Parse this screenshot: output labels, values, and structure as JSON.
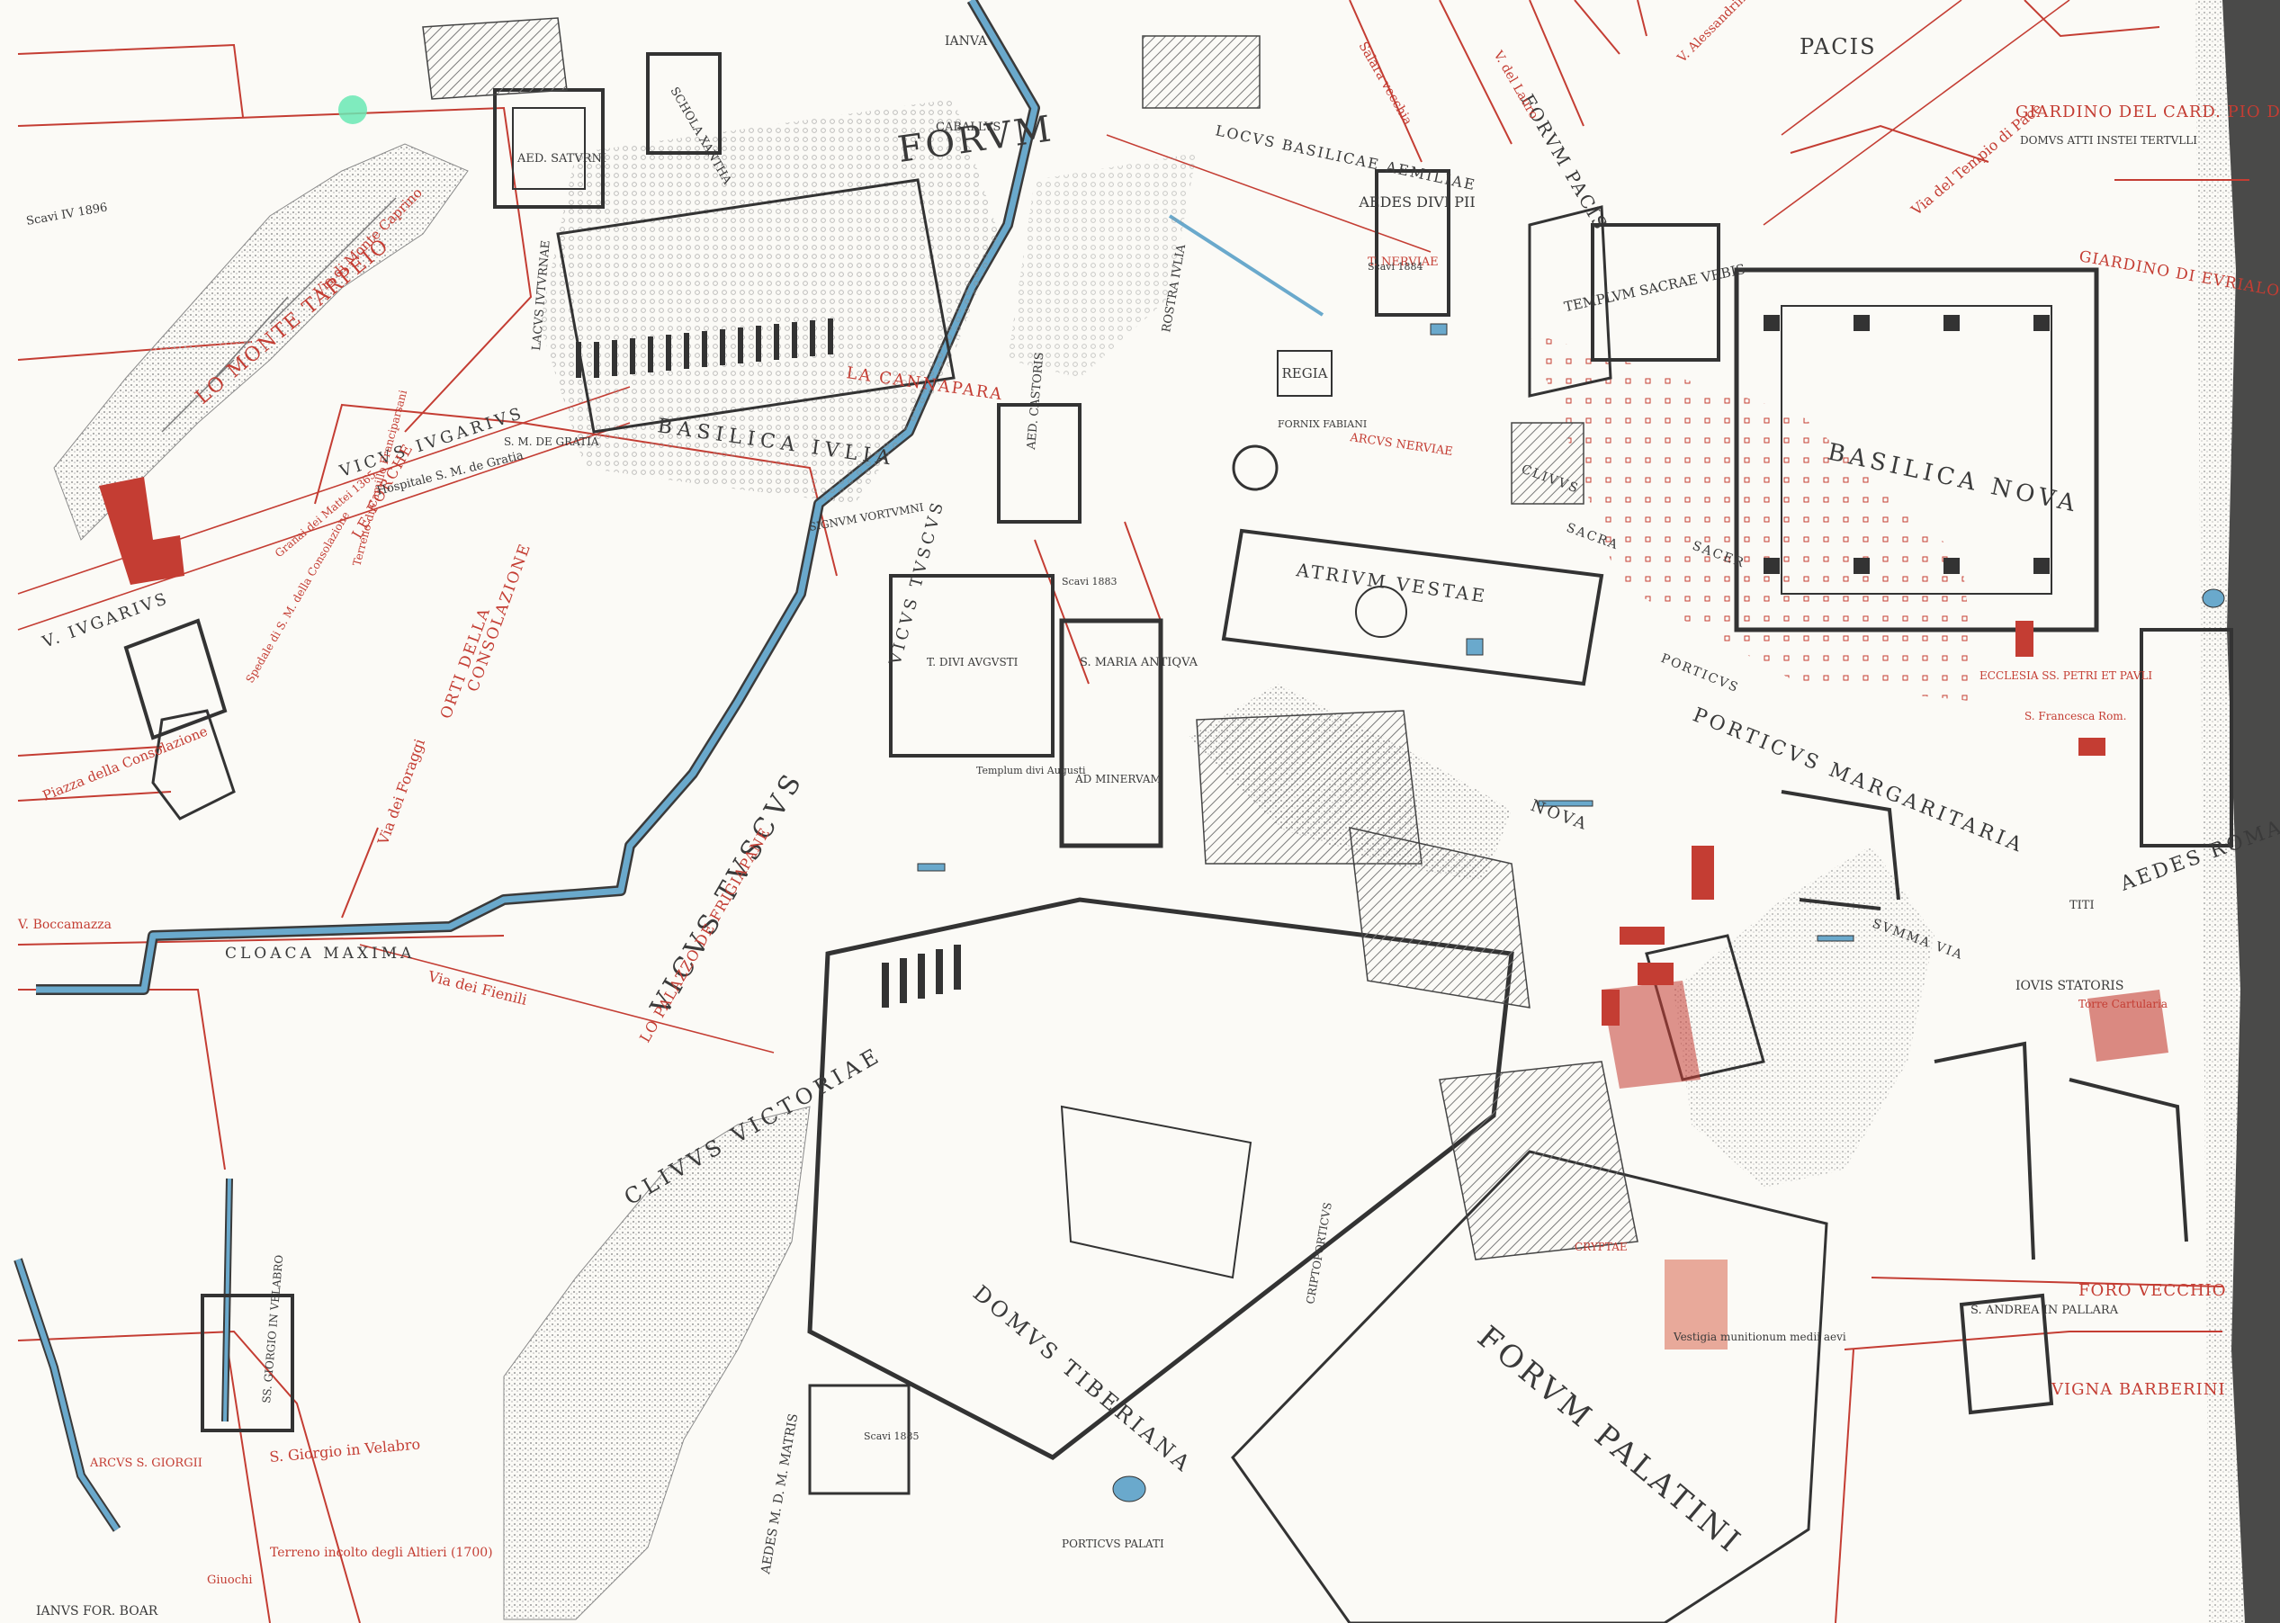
{
  "map": {
    "colors": {
      "paper": "#fbfaf6",
      "modern_red": "#c43d33",
      "ancient_ink": "#3a3a3a",
      "water_blue": "#6aa9cc",
      "hatch_grey": "#9a9a9a"
    },
    "labels": {
      "forum": "FORVM",
      "basilica_julia": "BASILICA IVLIA",
      "basilica_nova": "BASILICA NOVA",
      "forum_pacis": "FORVM PACIS",
      "pacis": "PACIS",
      "locus_basilicae": "LOCVS BASILICAE AEMILIAE",
      "aedes_divi_pii": "AEDES DIVI PII",
      "templum_sacrae_urbis": "TEMPLVM SACRAE VRBIS",
      "regia": "REGIA",
      "atrium_vestae": "ATRIVM VESTAE",
      "porticus_margaritaria": "PORTICVS MARGARITARIA",
      "nova_via": "NOVA",
      "summa_via": "SVMMA VIA",
      "vicus_jugarius": "VICVS IVGARIVS",
      "v_jugarius": "V. IVGARIVS",
      "vicus_tuscus_1": "VICVS TVSCVS",
      "vicus_tuscus_2": "VICVS TVSCVS",
      "clivus_victoriae": "CLIVVS VICTORIAE",
      "domus_tiberiana": "DOMVS TIBERIANA",
      "forum_palatini": "FORVM PALATINI",
      "aedes_romae": "AEDES ROMAE",
      "iovis_statoris": "IOVIS STATORIS",
      "cloaca_maxima": "CLOACA MAXIMA",
      "schola_xantha": "SCHOLA XANTHA",
      "aed_saturni": "AED. SATVRNI",
      "aed_castoris": "AED. CASTORIS",
      "s_maria_antiqua": "S. MARIA ANTIQVA",
      "ad_minervam": "AD MINERVAM",
      "t_divi_augusti": "T. DIVI AVGVSTI",
      "arcus_s_giorgii": "ARCVS S. GIORGII",
      "ianus_for_boar": "IANVS FOR. BOAR",
      "aedes_m_d_m_matris": "AEDES M. D. M. MATRIS",
      "cryptoporticus": "CRIPTOPORTICVS",
      "porticus": "PORTICVS",
      "sacra": "SACRA",
      "sacer": "SACER",
      "clivus": "CLIVVS",
      "giardino_pio_di_carpi": "GIARDINO DEL CARD. PIO DI CARPI",
      "giardino_evrialo": "GIARDINO DI EVRIALO SILVESTRI",
      "domus_atti": "DOMVS ATTI INSTEI TERTVLLI",
      "la_cannapara": "LA CANNAPARA",
      "monte_tarpeio": "LO MONTE TARPEIO",
      "via_monte_caprino": "Via di Monte Caprino",
      "le_forche": "LE FORCHE",
      "consolazione": "CONSOLAZIONE",
      "orti_della": "ORTI DELLA",
      "via_dei_foraggi": "Via dei Foraggi",
      "piazza_consolazione": "Piazza della Consolazione",
      "via_dei_fienili": "Via dei Fienili",
      "v_boccamazza": "V. Boccamazza",
      "s_giorgio_velabro": "S. Giorgio in Velabro",
      "palazzo_frigiapane": "LO PALAZZO DE FRIGIAPANE",
      "foro_vecchio": "FORO VECCHIO",
      "vigna_barberini": "VIGNA BARBERINI",
      "s_andrea_pallara": "S. ANDREA IN PALLARA",
      "turris_cartularia": "Torre Cartularia",
      "via_tempio_pace": "Via del Tempio di Pace",
      "salara_vecchia": "Salara vecchia",
      "v_del_lauro": "V. del Lauro",
      "alessandrina": "V. Alessandrina",
      "arcus_nerviae": "ARCVS NERVIAE",
      "t_nerviae": "T. NERVIAE",
      "rostra_iulia": "ROSTRA IVLIA",
      "hospitale": "Hospitale S. M. de Gratia",
      "s_m_de_gratia": "S. M. DE GRATIA",
      "vestigia": "Vestigia munitionum medii aevi",
      "caballus": "CABALLVS",
      "ianva": "IANVA",
      "lacus_iuturnae": "LACVS IVTVRNAE",
      "scavi_iv_1896": "Scavi IV 1896",
      "fornix_fabiani": "FORNIX FABIANI",
      "terreno_altieri": "Terreno incolto degli Altieri (1700)",
      "titi": "TITI",
      "sanctus_vortumni": "SIGNVM VORTVMNI",
      "ecclesia_ss_petri": "ECCLESIA SS. PETRI ET PAVLI",
      "s_francesca": "S. Francesca Rom.",
      "cryptae": "CRYPTAE",
      "ss_giorgio": "SS. GIORGIO IN VELABRO",
      "giuochi": "Giuochi",
      "porticus_palati": "PORTICVS PALATI",
      "scavi_1883": "Scavi 1883",
      "scavi_1884": "Scavi 1884",
      "scavi_1885": "Scavi 1885",
      "terreno_capranica": "Terreno di Camillo Franciparsani",
      "granai_mattei": "Granai dei Mattei 1365",
      "spedale": "Spedale di S. M. della Consolazione",
      "tem_1": "Templum divi Augusti"
    }
  }
}
